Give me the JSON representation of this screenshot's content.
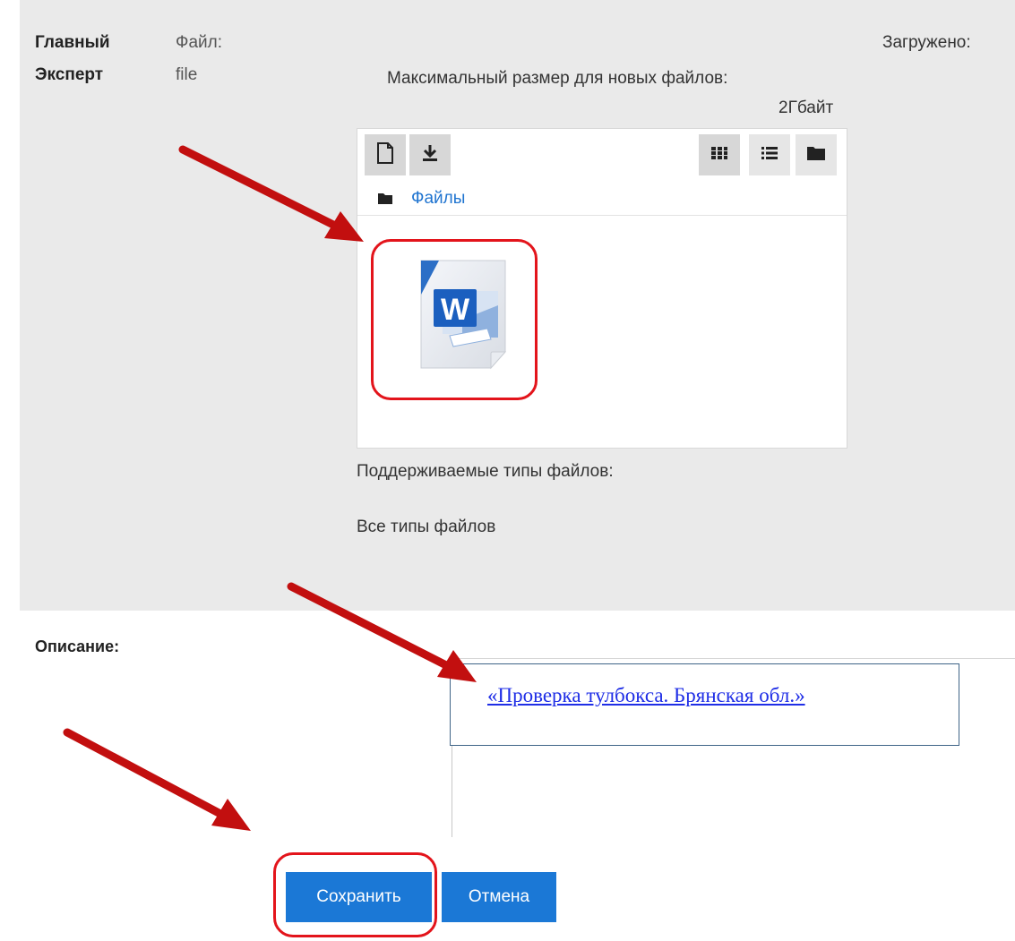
{
  "labels": {
    "field_name_line1": "Главный",
    "field_name_line2": "Эксперт",
    "file_label": "Файл:",
    "file_value": "file",
    "uploaded_label": "Загружено:",
    "max_size_label": "Максимальный размер для новых файлов:",
    "max_size_value": "2Гбайт",
    "supported_types_label": "Поддерживаемые типы файлов:",
    "supported_types_value": "Все типы файлов",
    "description_label": "Описание:"
  },
  "filepicker": {
    "toolbar": [
      "new-file-icon",
      "download-icon",
      "grid-view-icon",
      "list-view-icon",
      "folder-view-icon"
    ],
    "path_folder": "Файлы",
    "file_icon": "word-document-icon"
  },
  "textbox_link": "«Проверка тулбокса. Брянская обл.»",
  "buttons": {
    "save": "Сохранить",
    "cancel": "Отмена"
  },
  "colors": {
    "accent_blue": "#1b78d6",
    "highlight_red": "#e3141b",
    "arrow_red": "#c20f0f"
  }
}
